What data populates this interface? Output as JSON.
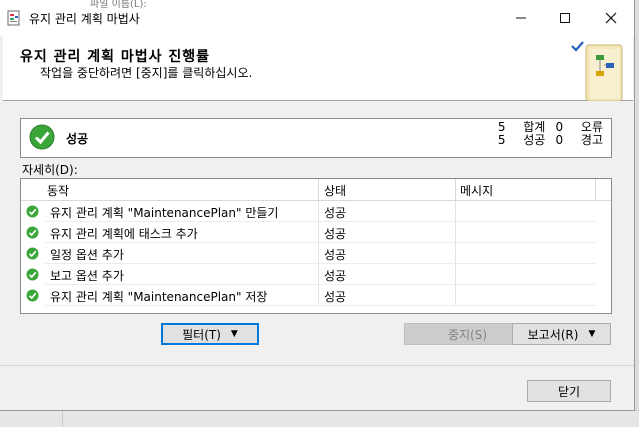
{
  "window": {
    "title": "유지 관리 계획 마법사"
  },
  "background": {
    "peek_text": "파일 이름(L):"
  },
  "header": {
    "title": "유지 관리 계획 마법사 진행률",
    "subtitle": "작업을 중단하려면 [중지]를 클릭하십시오."
  },
  "status": {
    "label": "성공",
    "stats": [
      {
        "count": "5",
        "label": "합계",
        "count2": "0",
        "label2": "오류"
      },
      {
        "count": "5",
        "label": "성공",
        "count2": "0",
        "label2": "경고"
      }
    ]
  },
  "details": {
    "label": "자세히(D):",
    "columns": [
      "동작",
      "상태",
      "메시지"
    ],
    "rows": [
      {
        "action": "유지 관리 계획 \"MaintenancePlan\" 만들기",
        "status": "성공",
        "message": ""
      },
      {
        "action": "유지 관리 계획에 태스크 추가",
        "status": "성공",
        "message": ""
      },
      {
        "action": "일정 옵션 추가",
        "status": "성공",
        "message": ""
      },
      {
        "action": "보고 옵션 추가",
        "status": "성공",
        "message": ""
      },
      {
        "action": "유지 관리 계획 \"MaintenancePlan\" 저장",
        "status": "성공",
        "message": ""
      }
    ]
  },
  "buttons": {
    "filter": "필터(T)",
    "stop": "중지(S)",
    "report": "보고서(R)",
    "close": "닫기"
  },
  "icons": {
    "app": "maintenance-plan-icon",
    "success": "success-check-icon"
  },
  "colors": {
    "success": "#3aa63a",
    "focus": "#0078d7"
  }
}
